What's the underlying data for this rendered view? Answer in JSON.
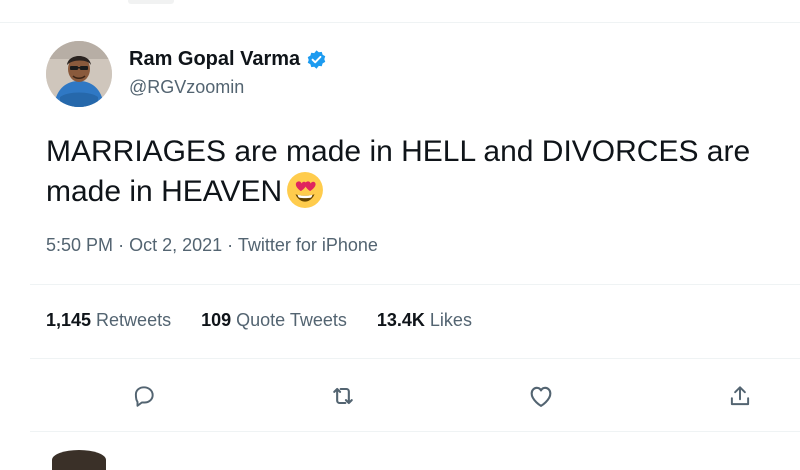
{
  "tweet": {
    "display_name": "Ram Gopal Varma",
    "handle": "@RGVzoomin",
    "text": "MARRIAGES are made in HELL and DIVORCES are made in HEAVEN",
    "emoji": "heart-eyes-emoji",
    "time": "5:50 PM",
    "separator": "·",
    "date": "Oct 2, 2021",
    "source": "Twitter for iPhone"
  },
  "stats": {
    "retweets": {
      "count": "1,145",
      "label": "Retweets"
    },
    "quotes": {
      "count": "109",
      "label": "Quote Tweets"
    },
    "likes": {
      "count": "13.4K",
      "label": "Likes"
    }
  },
  "icons": {
    "reply": "reply-icon",
    "retweet": "retweet-icon",
    "like": "like-icon",
    "share": "share-icon",
    "verified": "verified-badge-icon"
  },
  "colors": {
    "text_primary": "#0f1419",
    "text_secondary": "#536471",
    "verified_blue": "#1d9bf0",
    "divider": "#eff3f4"
  }
}
